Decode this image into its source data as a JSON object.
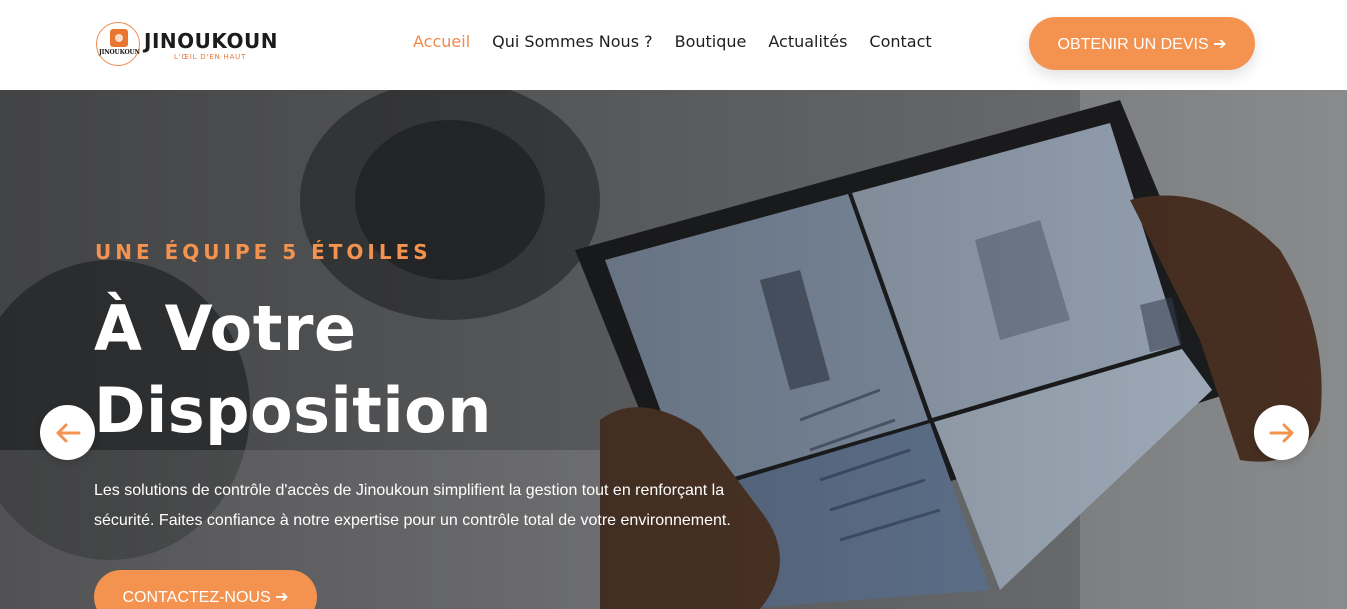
{
  "brand": {
    "name": "JINOUKOUN",
    "tagline": "L'ŒIL D'EN HAUT",
    "badge_text": "JINOUKOUN"
  },
  "nav": {
    "items": [
      {
        "label": "Accueil",
        "active": true
      },
      {
        "label": "Qui Sommes Nous ?",
        "active": false
      },
      {
        "label": "Boutique",
        "active": false
      },
      {
        "label": "Actualités",
        "active": false
      },
      {
        "label": "Contact",
        "active": false
      }
    ]
  },
  "header_cta": {
    "label": "OBTENIR UN DEVIS ➔"
  },
  "hero": {
    "eyebrow": "UNE ÉQUIPE 5 ÉTOILES",
    "headline_line1": "À Votre",
    "headline_line2": "Disposition",
    "paragraph": "Les solutions de contrôle d'accès de Jinoukoun simplifient la gestion tout en renforçant la sécurité. Faites confiance à notre expertise pour un contrôle total de votre environnement.",
    "cta_label": "CONTACTEZ-NOUS ➔",
    "prev_icon": "arrow-left-icon",
    "next_icon": "arrow-right-icon"
  },
  "colors": {
    "accent": "#f4934f",
    "accent_text": "#f08a4b",
    "nav_text": "#1f1f1f",
    "white": "#ffffff"
  }
}
